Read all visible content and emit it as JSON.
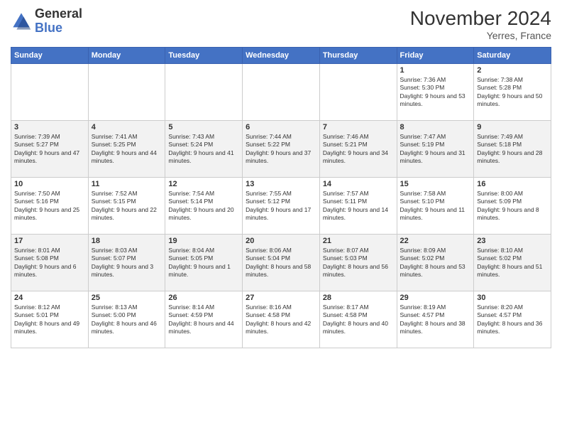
{
  "logo": {
    "general": "General",
    "blue": "Blue"
  },
  "header": {
    "month_title": "November 2024",
    "location": "Yerres, France"
  },
  "days_of_week": [
    "Sunday",
    "Monday",
    "Tuesday",
    "Wednesday",
    "Thursday",
    "Friday",
    "Saturday"
  ],
  "weeks": [
    [
      {
        "day": "",
        "info": ""
      },
      {
        "day": "",
        "info": ""
      },
      {
        "day": "",
        "info": ""
      },
      {
        "day": "",
        "info": ""
      },
      {
        "day": "",
        "info": ""
      },
      {
        "day": "1",
        "info": "Sunrise: 7:36 AM\nSunset: 5:30 PM\nDaylight: 9 hours and 53 minutes."
      },
      {
        "day": "2",
        "info": "Sunrise: 7:38 AM\nSunset: 5:28 PM\nDaylight: 9 hours and 50 minutes."
      }
    ],
    [
      {
        "day": "3",
        "info": "Sunrise: 7:39 AM\nSunset: 5:27 PM\nDaylight: 9 hours and 47 minutes."
      },
      {
        "day": "4",
        "info": "Sunrise: 7:41 AM\nSunset: 5:25 PM\nDaylight: 9 hours and 44 minutes."
      },
      {
        "day": "5",
        "info": "Sunrise: 7:43 AM\nSunset: 5:24 PM\nDaylight: 9 hours and 41 minutes."
      },
      {
        "day": "6",
        "info": "Sunrise: 7:44 AM\nSunset: 5:22 PM\nDaylight: 9 hours and 37 minutes."
      },
      {
        "day": "7",
        "info": "Sunrise: 7:46 AM\nSunset: 5:21 PM\nDaylight: 9 hours and 34 minutes."
      },
      {
        "day": "8",
        "info": "Sunrise: 7:47 AM\nSunset: 5:19 PM\nDaylight: 9 hours and 31 minutes."
      },
      {
        "day": "9",
        "info": "Sunrise: 7:49 AM\nSunset: 5:18 PM\nDaylight: 9 hours and 28 minutes."
      }
    ],
    [
      {
        "day": "10",
        "info": "Sunrise: 7:50 AM\nSunset: 5:16 PM\nDaylight: 9 hours and 25 minutes."
      },
      {
        "day": "11",
        "info": "Sunrise: 7:52 AM\nSunset: 5:15 PM\nDaylight: 9 hours and 22 minutes."
      },
      {
        "day": "12",
        "info": "Sunrise: 7:54 AM\nSunset: 5:14 PM\nDaylight: 9 hours and 20 minutes."
      },
      {
        "day": "13",
        "info": "Sunrise: 7:55 AM\nSunset: 5:12 PM\nDaylight: 9 hours and 17 minutes."
      },
      {
        "day": "14",
        "info": "Sunrise: 7:57 AM\nSunset: 5:11 PM\nDaylight: 9 hours and 14 minutes."
      },
      {
        "day": "15",
        "info": "Sunrise: 7:58 AM\nSunset: 5:10 PM\nDaylight: 9 hours and 11 minutes."
      },
      {
        "day": "16",
        "info": "Sunrise: 8:00 AM\nSunset: 5:09 PM\nDaylight: 9 hours and 8 minutes."
      }
    ],
    [
      {
        "day": "17",
        "info": "Sunrise: 8:01 AM\nSunset: 5:08 PM\nDaylight: 9 hours and 6 minutes."
      },
      {
        "day": "18",
        "info": "Sunrise: 8:03 AM\nSunset: 5:07 PM\nDaylight: 9 hours and 3 minutes."
      },
      {
        "day": "19",
        "info": "Sunrise: 8:04 AM\nSunset: 5:05 PM\nDaylight: 9 hours and 1 minute."
      },
      {
        "day": "20",
        "info": "Sunrise: 8:06 AM\nSunset: 5:04 PM\nDaylight: 8 hours and 58 minutes."
      },
      {
        "day": "21",
        "info": "Sunrise: 8:07 AM\nSunset: 5:03 PM\nDaylight: 8 hours and 56 minutes."
      },
      {
        "day": "22",
        "info": "Sunrise: 8:09 AM\nSunset: 5:02 PM\nDaylight: 8 hours and 53 minutes."
      },
      {
        "day": "23",
        "info": "Sunrise: 8:10 AM\nSunset: 5:02 PM\nDaylight: 8 hours and 51 minutes."
      }
    ],
    [
      {
        "day": "24",
        "info": "Sunrise: 8:12 AM\nSunset: 5:01 PM\nDaylight: 8 hours and 49 minutes."
      },
      {
        "day": "25",
        "info": "Sunrise: 8:13 AM\nSunset: 5:00 PM\nDaylight: 8 hours and 46 minutes."
      },
      {
        "day": "26",
        "info": "Sunrise: 8:14 AM\nSunset: 4:59 PM\nDaylight: 8 hours and 44 minutes."
      },
      {
        "day": "27",
        "info": "Sunrise: 8:16 AM\nSunset: 4:58 PM\nDaylight: 8 hours and 42 minutes."
      },
      {
        "day": "28",
        "info": "Sunrise: 8:17 AM\nSunset: 4:58 PM\nDaylight: 8 hours and 40 minutes."
      },
      {
        "day": "29",
        "info": "Sunrise: 8:19 AM\nSunset: 4:57 PM\nDaylight: 8 hours and 38 minutes."
      },
      {
        "day": "30",
        "info": "Sunrise: 8:20 AM\nSunset: 4:57 PM\nDaylight: 8 hours and 36 minutes."
      }
    ]
  ]
}
